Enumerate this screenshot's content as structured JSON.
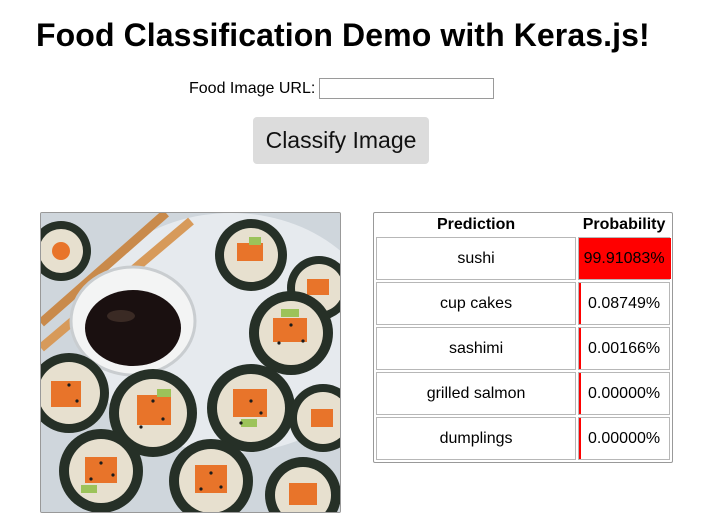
{
  "page": {
    "title": "Food Classification Demo with Keras.js!"
  },
  "form": {
    "url_label": "Food Image URL:",
    "url_value": "",
    "classify_label": "Classify Image"
  },
  "results": {
    "headers": {
      "prediction": "Prediction",
      "probability": "Probability"
    },
    "bar_color": "#ff0000",
    "rows": [
      {
        "label": "sushi",
        "percent": "99.91083%",
        "value": 0.9991083
      },
      {
        "label": "cup cakes",
        "percent": "0.08749%",
        "value": 0.0008749
      },
      {
        "label": "sashimi",
        "percent": "0.00166%",
        "value": 1.66e-05
      },
      {
        "label": "grilled salmon",
        "percent": "0.00000%",
        "value": 0.0
      },
      {
        "label": "dumplings",
        "percent": "0.00000%",
        "value": 0.0
      }
    ]
  }
}
